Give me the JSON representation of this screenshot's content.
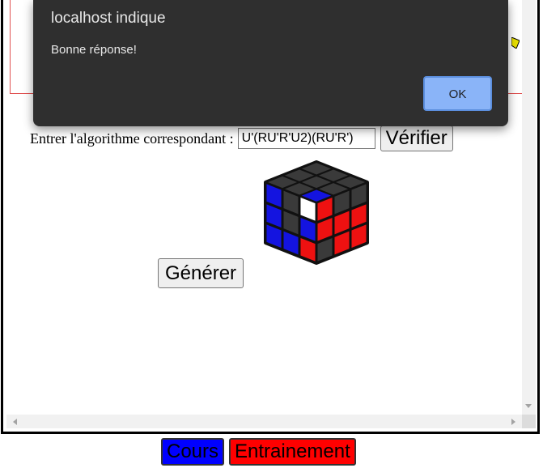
{
  "page": {
    "algo_label": "Entrer l'algorithme correspondant :",
    "algo_value": "U'(RU'R'U2)(RU'R')",
    "verify_label": "Vérifier",
    "generate_label": "Générer"
  },
  "cube": {
    "colors": {
      "dark": "#3a3a3a",
      "blue": "#1414e0",
      "red": "#ee1111",
      "white": "#ffffff"
    },
    "top": [
      "dark",
      "dark",
      "dark",
      "dark",
      "dark",
      "dark",
      "dark",
      "dark",
      "blue"
    ],
    "left": [
      "blue",
      "dark",
      "white",
      "blue",
      "dark",
      "blue",
      "blue",
      "blue",
      "red"
    ],
    "right": [
      "red",
      "dark",
      "dark",
      "red",
      "red",
      "red",
      "dark",
      "red",
      "red"
    ]
  },
  "nav": {
    "cours_label": "Cours",
    "cours_color": "#0000ff",
    "entrainement_label": "Entrainement",
    "entrainement_color": "#ff0000"
  },
  "dialog": {
    "title": "localhost indique",
    "message": "Bonne réponse!",
    "ok_label": "OK"
  }
}
